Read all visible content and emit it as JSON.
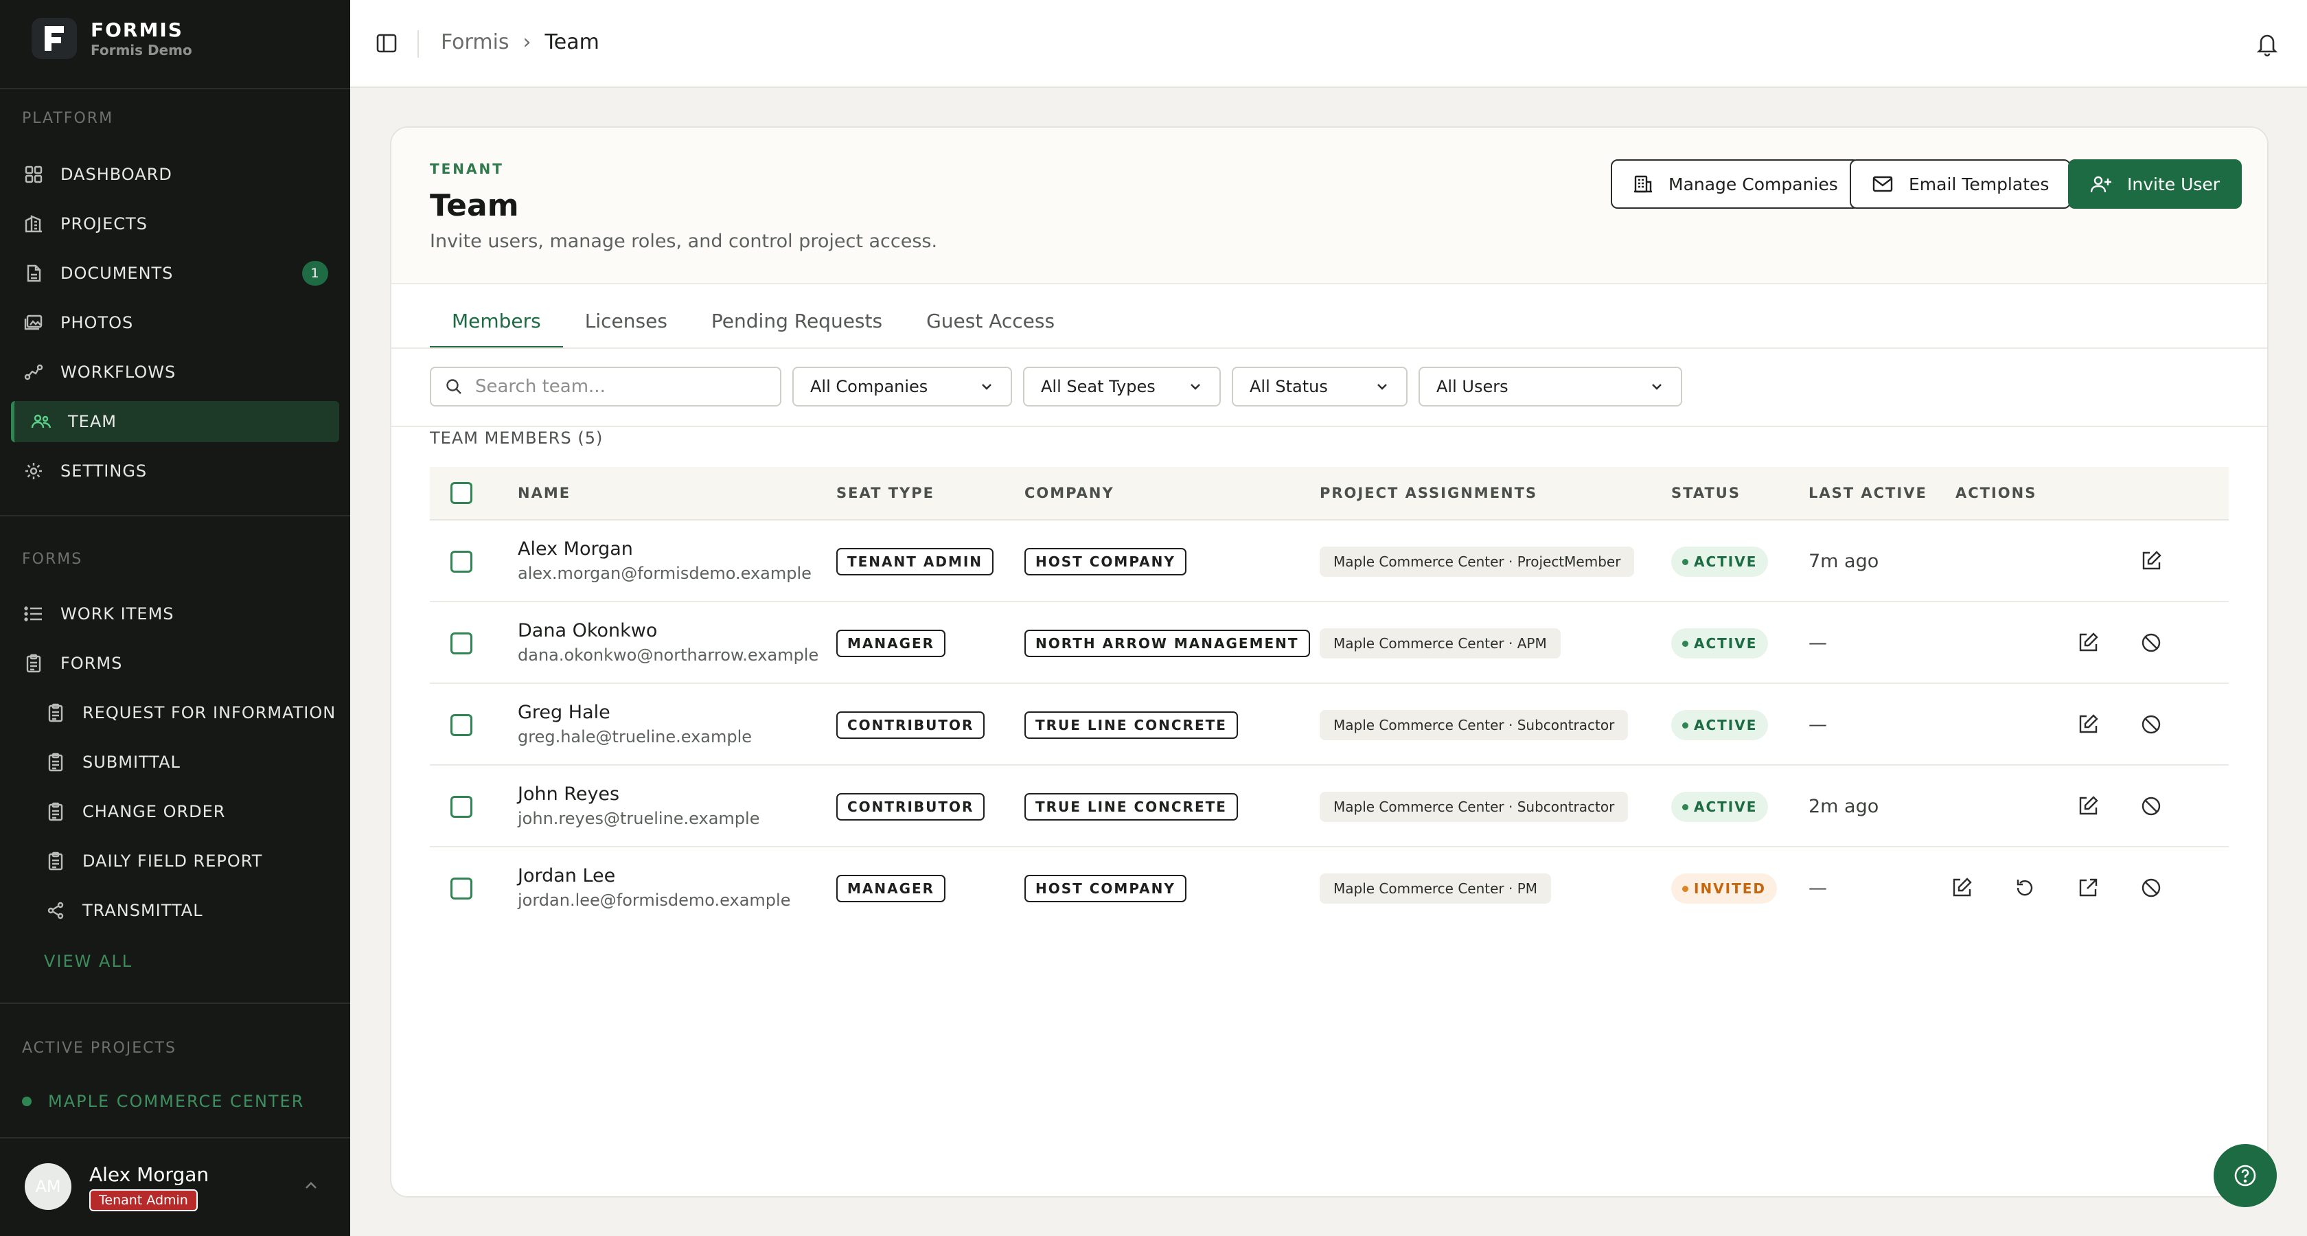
{
  "brand": {
    "name": "FORMIS",
    "tenant": "Formis Demo"
  },
  "sidebar": {
    "platform_label": "PLATFORM",
    "platform_items": [
      {
        "label": "DASHBOARD",
        "icon": "grid-icon"
      },
      {
        "label": "PROJECTS",
        "icon": "building-icon"
      },
      {
        "label": "DOCUMENTS",
        "icon": "document-icon",
        "badge": "1"
      },
      {
        "label": "PHOTOS",
        "icon": "photos-icon"
      },
      {
        "label": "WORKFLOWS",
        "icon": "workflow-icon"
      },
      {
        "label": "TEAM",
        "icon": "team-icon",
        "active": true
      },
      {
        "label": "SETTINGS",
        "icon": "gear-icon"
      }
    ],
    "forms_label": "FORMS",
    "forms_items": [
      {
        "label": "WORK ITEMS",
        "icon": "list-icon"
      },
      {
        "label": "FORMS",
        "icon": "clipboard-icon"
      }
    ],
    "form_types": [
      {
        "label": "REQUEST FOR INFORMATION",
        "icon": "clipboard-icon"
      },
      {
        "label": "SUBMITTAL",
        "icon": "clipboard-icon"
      },
      {
        "label": "CHANGE ORDER",
        "icon": "clipboard-icon"
      },
      {
        "label": "DAILY FIELD REPORT",
        "icon": "clipboard-icon"
      },
      {
        "label": "TRANSMITTAL",
        "icon": "share-icon"
      }
    ],
    "view_all": "VIEW ALL",
    "active_projects_label": "ACTIVE PROJECTS",
    "active_projects": [
      "MAPLE COMMERCE CENTER"
    ]
  },
  "user": {
    "initials": "AM",
    "name": "Alex Morgan",
    "role": "Tenant Admin"
  },
  "breadcrumb": {
    "root": "Formis",
    "separator": "›",
    "current": "Team"
  },
  "header": {
    "eyebrow": "TENANT",
    "title": "Team",
    "description": "Invite users, manage roles, and control project access.",
    "buttons": {
      "manage_companies": "Manage Companies",
      "email_templates": "Email Templates",
      "invite_user": "Invite User"
    }
  },
  "tabs": [
    "Members",
    "Licenses",
    "Pending Requests",
    "Guest Access"
  ],
  "filters": {
    "search_placeholder": "Search team...",
    "company": "All Companies",
    "seat_type": "All Seat Types",
    "status": "All Status",
    "users": "All Users"
  },
  "members_title": "TEAM MEMBERS (5)",
  "table": {
    "columns": {
      "name": "NAME",
      "seat_type": "SEAT TYPE",
      "company": "COMPANY",
      "assignments": "PROJECT ASSIGNMENTS",
      "status": "STATUS",
      "last_active": "LAST ACTIVE",
      "actions": "ACTIONS"
    },
    "rows": [
      {
        "name": "Alex Morgan",
        "email": "alex.morgan@formisdemo.example",
        "seat": "TENANT ADMIN",
        "company": "HOST COMPANY",
        "assignment": "Maple Commerce Center · ProjectMember",
        "status": "ACTIVE",
        "last_active": "7m ago",
        "actions": [
          "edit"
        ]
      },
      {
        "name": "Dana Okonkwo",
        "email": "dana.okonkwo@northarrow.example",
        "seat": "MANAGER",
        "company": "NORTH ARROW MANAGEMENT",
        "assignment": "Maple Commerce Center · APM",
        "status": "ACTIVE",
        "last_active": "—",
        "actions": [
          "edit",
          "block"
        ]
      },
      {
        "name": "Greg Hale",
        "email": "greg.hale@trueline.example",
        "seat": "CONTRIBUTOR",
        "company": "TRUE LINE CONCRETE",
        "assignment": "Maple Commerce Center · Subcontractor",
        "status": "ACTIVE",
        "last_active": "—",
        "actions": [
          "edit",
          "block"
        ]
      },
      {
        "name": "John Reyes",
        "email": "john.reyes@trueline.example",
        "seat": "CONTRIBUTOR",
        "company": "TRUE LINE CONCRETE",
        "assignment": "Maple Commerce Center · Subcontractor",
        "status": "ACTIVE",
        "last_active": "2m ago",
        "actions": [
          "edit",
          "block"
        ]
      },
      {
        "name": "Jordan Lee",
        "email": "jordan.lee@formisdemo.example",
        "seat": "MANAGER",
        "company": "HOST COMPANY",
        "assignment": "Maple Commerce Center · PM",
        "status": "INVITED",
        "last_active": "—",
        "actions": [
          "edit",
          "resend",
          "open",
          "block"
        ]
      }
    ]
  },
  "colors": {
    "accent": "#1c6b42",
    "sidebar_bg": "#161816",
    "active_green": "#2f8653",
    "invited_orange": "#c4670f",
    "role_badge": "#b72a2a"
  }
}
